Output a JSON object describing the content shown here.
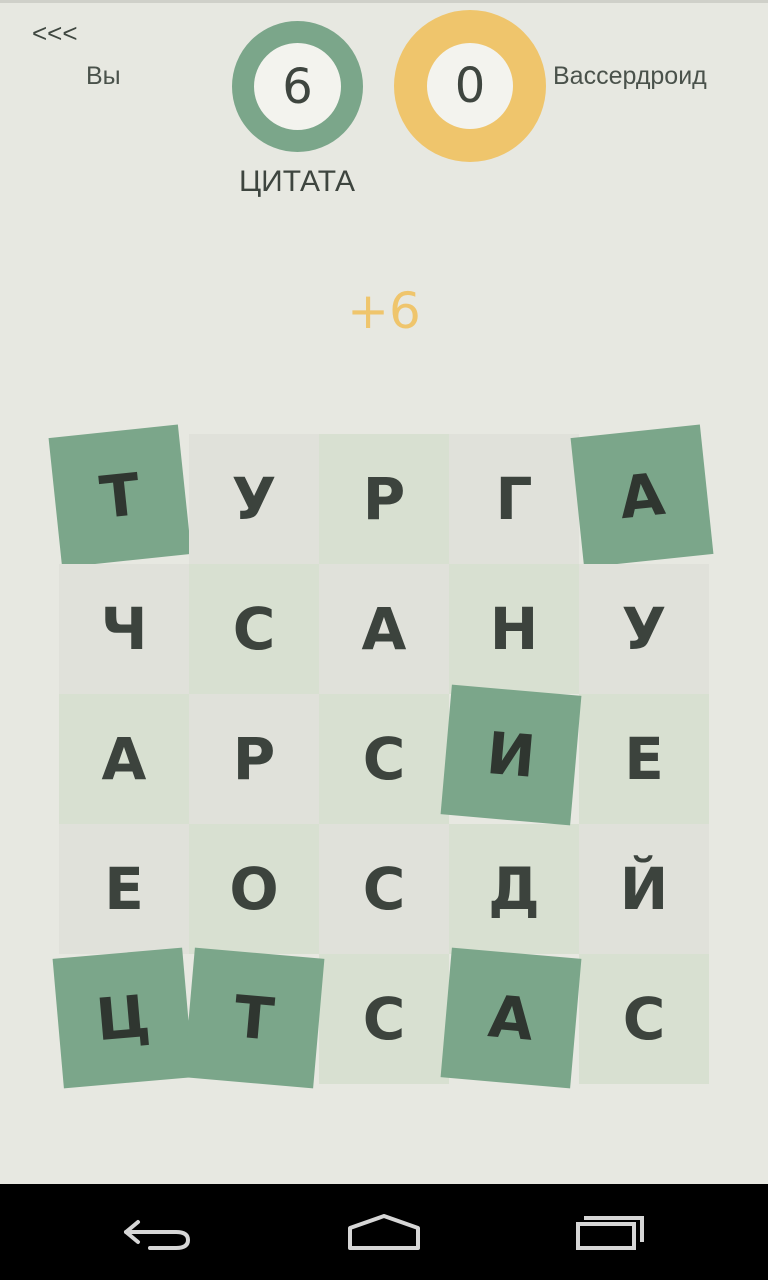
{
  "header": {
    "back_label": "<<<",
    "player_name": "Вы",
    "opponent_name": "Вассердроид",
    "player_score": "6",
    "opponent_score": "0",
    "player_ring_color": "#7ba68a",
    "opponent_ring_color": "#efc56c"
  },
  "current_word": "ЦИТАТА",
  "score_gain": "+6",
  "board": {
    "rows": [
      [
        "Т",
        "У",
        "Р",
        "Г",
        "А"
      ],
      [
        "Ч",
        "С",
        "А",
        "Н",
        "У"
      ],
      [
        "А",
        "Р",
        "С",
        "И",
        "Е"
      ],
      [
        "Е",
        "О",
        "С",
        "Д",
        "Й"
      ],
      [
        "Ц",
        "Т",
        "С",
        "А",
        "С"
      ]
    ],
    "selected_color": "#7ba68a",
    "light_gray": "#e0e1da",
    "light_green": "#d8e0d1"
  },
  "navbar": {
    "back_icon": "back-arrow-icon",
    "home_icon": "home-icon",
    "recents_icon": "recents-icon"
  }
}
